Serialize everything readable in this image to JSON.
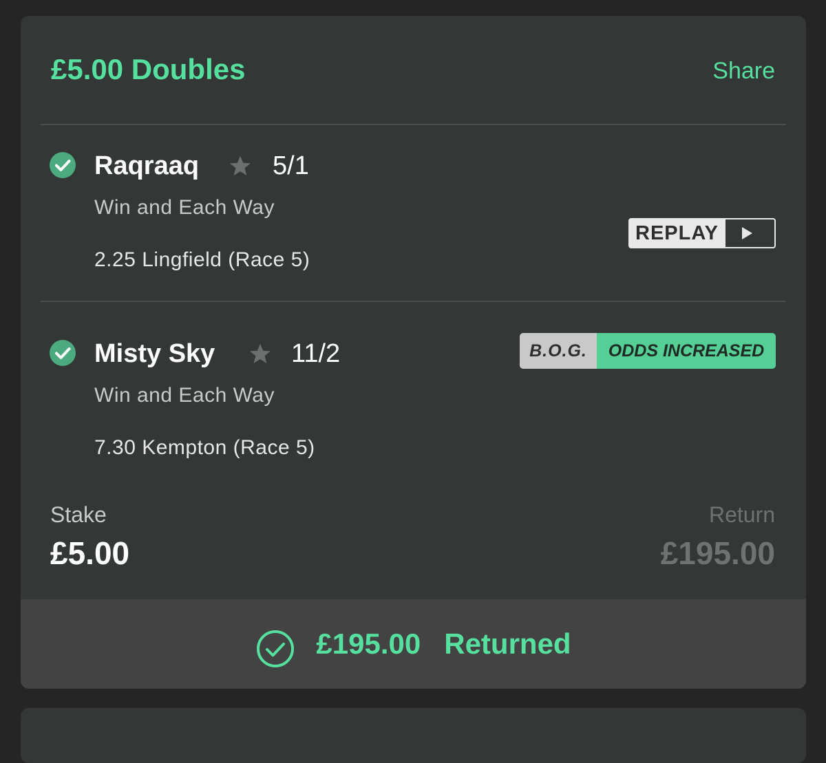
{
  "bet": {
    "title": "£5.00 Doubles",
    "share_label": "Share",
    "stake_label": "Stake",
    "stake_value": "£5.00",
    "return_label": "Return",
    "return_value": "£195.00"
  },
  "selections": [
    {
      "runner": "Raqraaq",
      "odds": "5/1",
      "bet_type": "Win and Each Way",
      "race": "2.25 Lingfield (Race 5)",
      "status": "won",
      "replay_label": "REPLAY"
    },
    {
      "runner": "Misty Sky",
      "odds": "11/2",
      "bet_type": "Win and Each Way",
      "race": "7.30 Kempton (Race 5)",
      "status": "won",
      "bog_label": "B.O.G.",
      "bog_text": "ODDS INCREASED"
    }
  ],
  "footer": {
    "amount": "£195.00",
    "text": "Returned"
  },
  "colors": {
    "accent": "#56e0a0",
    "card_bg": "#333735",
    "page_bg": "#252525",
    "footer_bg": "#434343",
    "check_bg": "#4caa80"
  },
  "icons": {
    "check": "check-circle-icon",
    "star": "star-icon",
    "play": "play-icon",
    "returned": "check-circle-outline-icon"
  }
}
